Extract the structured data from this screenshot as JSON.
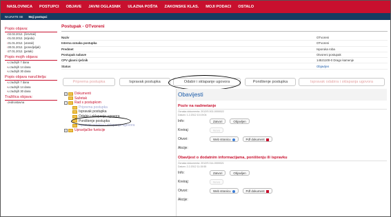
{
  "topnav": {
    "items": [
      "NASLOVNICA",
      "POSTUPCI",
      "OBJAVE",
      "JAVNI OGLASNIK",
      "ULAZNA POŠTA",
      "ZAKONSKE KLAS.",
      "MOJI PODACI",
      "OSTALO"
    ]
  },
  "subnav": {
    "items": [
      "NAJAVITE SE",
      "Moji postupci"
    ]
  },
  "sidebar": {
    "sections": [
      {
        "title": "Popis objava:",
        "items": [
          "02.02.2012. (četvrtak)",
          "01.02.2012. (srijeda)",
          "31.01.2012. (utorak)",
          "30.01.2012. (ponedjeljak)",
          "27.01.2012. (petak)"
        ]
      },
      {
        "title": "Popis mojih objava:",
        "items": [
          "u zadnjih 7 dana",
          "u zadnjih 14 dana",
          "u zadnjih 30 dana"
        ]
      },
      {
        "title": "Popis objava naručitelja:",
        "items": [
          "u zadnjih 7 dana",
          "u zadnjih 14 dana",
          "u zadnjih 30 dana"
        ]
      },
      {
        "title": "Tražilica objava:",
        "items": [
          "Jednostavna"
        ]
      }
    ]
  },
  "main": {
    "title": "Postupak - OTvoreni",
    "info": [
      {
        "label": "Naziv",
        "value": "OTvoreni"
      },
      {
        "label": "Interna oznaka postupka",
        "value": "OTvoreni"
      },
      {
        "label": "Predmet",
        "value": "Isporuka roba"
      },
      {
        "label": "Postupak nabave",
        "value": "Otvoreni postupak"
      },
      {
        "label": "CPV glavni rječnik",
        "value": "14521100-0 Drago kamenje"
      },
      {
        "label": "Status",
        "value": "Objavljen"
      }
    ],
    "tabs": [
      "Priprema postupka",
      "Ispravak postupka",
      "Odabir i sklapanje ugovora",
      "Poništenje postupka",
      "Ispravak odabira i sklapanja ugovora"
    ]
  },
  "tree": {
    "items": [
      "Dokumenti",
      "Sažetak",
      "Rad s postupkom",
      "Priprema postupka",
      "Ispravak postupka",
      "Odabir i sklapanje ugovora",
      "Poništenje postupka",
      "Ispravak odabira i sklapanja ugovora",
      "Upravljačke funkcije"
    ]
  },
  "panel": {
    "header": "Obavijesti",
    "notices": [
      {
        "title": "Poziv na nadmetanje",
        "meta1": "Oznaka dokumenta: 2012/S 002-0000022",
        "meta2": "Datum: 1.2.2012 10:19:04",
        "labels": [
          "Info:",
          "Kreiraj:",
          "Otvori:",
          "Akcije:"
        ],
        "btn_info1": "Zatvori",
        "btn_info2": "Objavljen",
        "btn_kreiraj": "Novo",
        "btn_web": "Web stranicu",
        "btn_pdf": "Pdf dokument"
      },
      {
        "title": "Obavijest o dodatnim informacijama, poništenju ili ispravku",
        "meta1": "Oznaka dokumenta: 2012/S 014-0000021",
        "meta2": "Datum: 2.2.2012 11:15:55",
        "labels": [
          "Info:",
          "Kreiraj:",
          "Otvori:",
          "Akcije:"
        ],
        "btn_info1": "Zatvori",
        "btn_info2": "Objavljen",
        "btn_kreiraj": "Novo",
        "btn_web": "Web stranicu",
        "btn_pdf": "Pdf dokument"
      }
    ]
  },
  "colors": {
    "brand_red": "#c8102e",
    "nav_blue": "#163c61",
    "link_blue": "#1a5aa8"
  }
}
